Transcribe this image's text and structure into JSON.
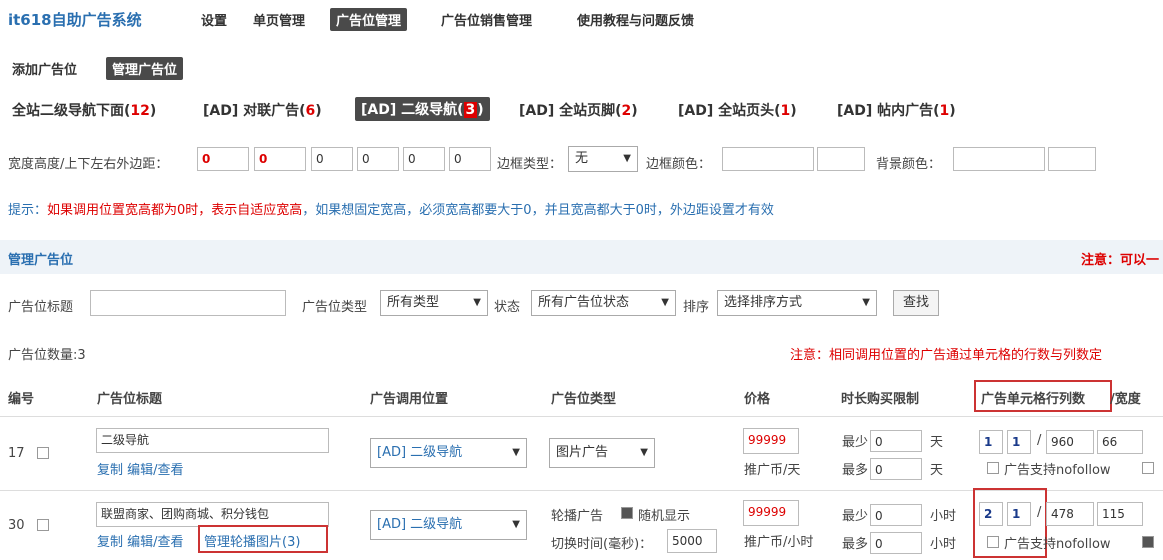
{
  "header": {
    "brand": "it618自助广告系统",
    "nav": [
      "设置",
      "单页管理",
      "广告位管理",
      "广告位销售管理",
      "使用教程与问题反馈"
    ]
  },
  "subnav": {
    "add": "添加广告位",
    "manage": "管理广告位"
  },
  "categories": [
    {
      "label": "全站二级导航下面(",
      "count": "12",
      "end": ")"
    },
    {
      "label": "[AD] 对联广告(",
      "count": "6",
      "end": ")"
    },
    {
      "label": "[AD] 二级导航(",
      "count": "3",
      "end": ")"
    },
    {
      "label": "[AD] 全站页脚(",
      "count": "2",
      "end": ")"
    },
    {
      "label": "[AD] 全站页头(",
      "count": "1",
      "end": ")"
    },
    {
      "label": "[AD] 帖内广告(",
      "count": "1",
      "end": ")"
    }
  ],
  "settings": {
    "size_label": "宽度高度/上下左右外边距：",
    "values": [
      "0",
      "0",
      "0",
      "0",
      "0",
      "0"
    ],
    "border_type_label": "边框类型：",
    "border_type_value": "无",
    "border_color_label": "边框颜色：",
    "bg_color_label": "背景颜色："
  },
  "tip": {
    "prefix": "提示：",
    "red": "如果调用位置宽高都为0时，表示自适应宽高",
    "rest": "，如果想固定宽高，必须宽高都要大于0，并且宽高都大于0时，外边距设置才有效"
  },
  "panel": {
    "title": "管理广告位",
    "note": "注意：可以一"
  },
  "filter": {
    "title_label": "广告位标题",
    "type_label": "广告位类型",
    "type_value": "所有类型",
    "status_label": "状态",
    "status_value": "所有广告位状态",
    "sort_label": "排序",
    "sort_value": "选择排序方式",
    "search_button": "查找"
  },
  "count_text": "广告位数量:3",
  "count_note": "注意：相同调用位置的广告通过单元格的行数与列数定",
  "table": {
    "headers": [
      "编号",
      "广告位标题",
      "广告调用位置",
      "广告位类型",
      "价格",
      "时长购买限制",
      "广告单元格行列数",
      "/宽度"
    ],
    "rows": [
      {
        "id": "17",
        "title": "二级导航",
        "actions": "复制 编辑/查看",
        "manage_link": "",
        "position": "[AD] 二级导航",
        "type": "图片广告",
        "type_extra": "",
        "switch_label": "",
        "switch_value": "",
        "price": "99999",
        "price_unit": "推广币/天",
        "min_label": "最少",
        "min_value": "0",
        "max_label": "最多",
        "max_value": "0",
        "unit": "天",
        "rows_val": "1",
        "cols_val": "1",
        "width": "960",
        "height": "66",
        "nofollow": "广告支持nofollow"
      },
      {
        "id": "30",
        "title": "联盟商家、团购商城、积分钱包",
        "actions": "复制 编辑/查看",
        "manage_link": "管理轮播图片(3)",
        "position": "[AD] 二级导航",
        "type": "轮播广告",
        "type_extra": "随机显示",
        "switch_label": "切换时间(毫秒)：",
        "switch_value": "5000",
        "price": "99999",
        "price_unit": "推广币/小时",
        "min_label": "最少",
        "min_value": "0",
        "max_label": "最多",
        "max_value": "0",
        "unit": "小时",
        "rows_val": "2",
        "cols_val": "1",
        "width": "478",
        "height": "115",
        "nofollow": "广告支持nofollow"
      }
    ]
  }
}
